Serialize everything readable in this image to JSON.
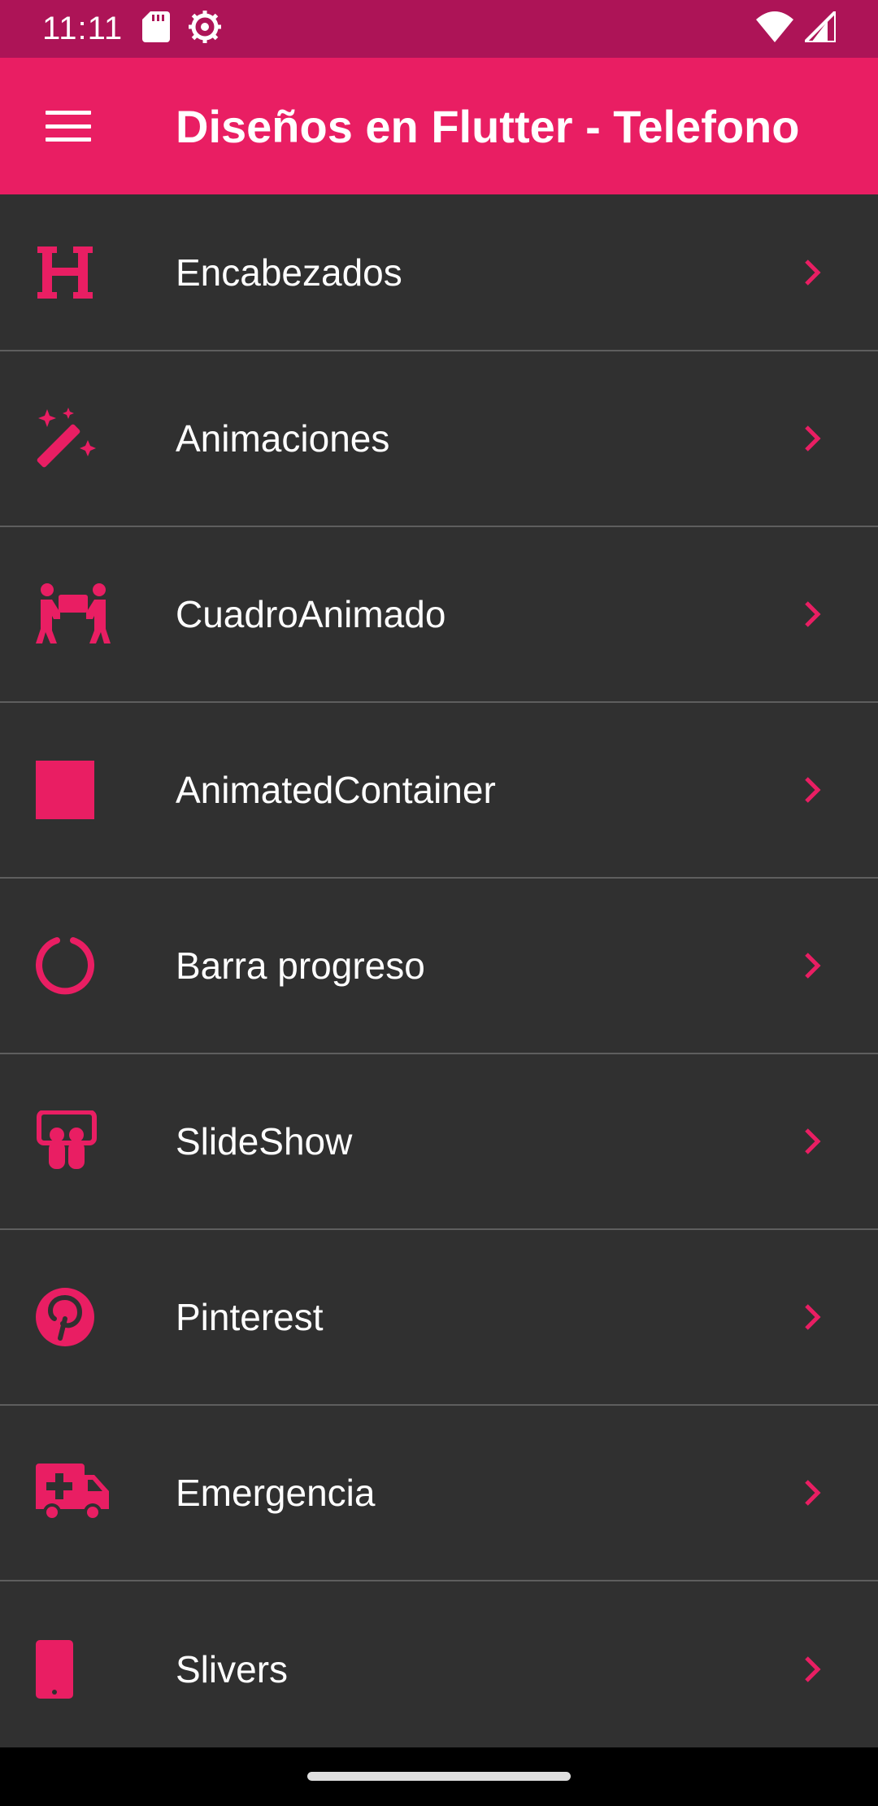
{
  "status_bar": {
    "time": "11:11",
    "icons_left": [
      "sd-card-icon",
      "settings-gear-icon"
    ],
    "icons_right": [
      "wifi-icon",
      "cell-signal-icon"
    ]
  },
  "app_bar": {
    "title": "Diseños en Flutter - Telefono",
    "menu_icon": "menu-icon"
  },
  "colors": {
    "accent": "#e91e63",
    "status_bar": "#ad1457",
    "background": "#303030",
    "divider": "#5e5e5e",
    "text": "#ffffff"
  },
  "items": [
    {
      "label": "Encabezados",
      "icon": "heading-icon"
    },
    {
      "label": "Animaciones",
      "icon": "magic-wand-icon"
    },
    {
      "label": "CuadroAnimado",
      "icon": "people-carry-icon"
    },
    {
      "label": "AnimatedContainer",
      "icon": "square-icon"
    },
    {
      "label": "Barra progreso",
      "icon": "circle-notch-icon"
    },
    {
      "label": "SlideShow",
      "icon": "slideshare-icon"
    },
    {
      "label": "Pinterest",
      "icon": "pinterest-icon"
    },
    {
      "label": "Emergencia",
      "icon": "ambulance-icon"
    },
    {
      "label": "Slivers",
      "icon": "mobile-icon"
    }
  ]
}
